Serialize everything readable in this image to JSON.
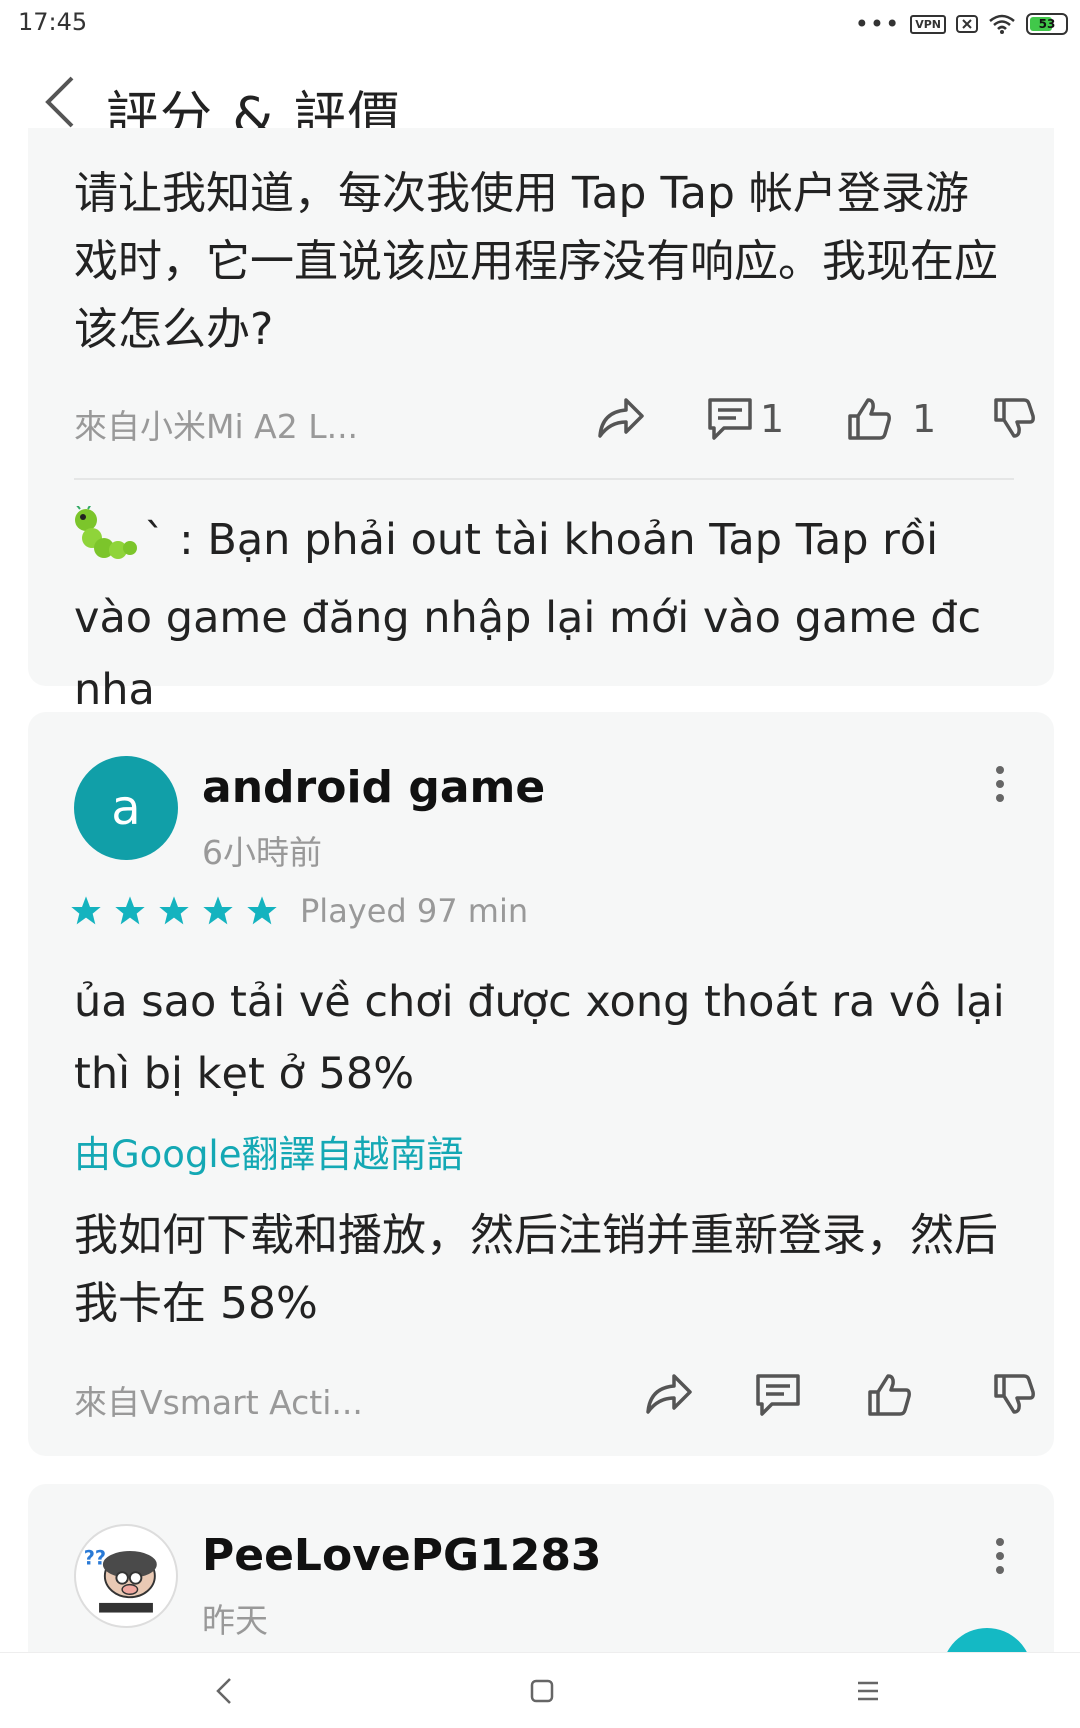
{
  "status_bar": {
    "time": "17:45",
    "vpn_label": "VPN",
    "battery_level": "53"
  },
  "header": {
    "title": "評分 & 評價"
  },
  "card1": {
    "text": "请让我知道，每次我使用 Tap Tap 帐户登录游戏时，它一直说该应用程序没有响应。我现在应该怎么办?",
    "device": "來自小米Mi A2 L...",
    "comment_count": "1",
    "like_count": "1",
    "reply_author": "`",
    "reply_text": " : Bạn phải out tài khoản Tap Tap rồi vào game đăng nhập lại mới vào game đc nha"
  },
  "card2": {
    "avatar_letter": "a",
    "username": "android game",
    "time_ago": "6小時前",
    "rating": 5,
    "played": "Played 97 min",
    "original_text": "ủa sao tải về chơi được xong thoát ra vô lại thì bị kẹt ở 58%",
    "translate_note": "由Google翻譯自越南語",
    "translated_text": "我如何下载和播放，然后注销并重新登录，然后我卡在 58%",
    "device": "來自Vsmart Acti..."
  },
  "card3": {
    "username": "PeeLovePG1283",
    "time_ago": "昨天"
  },
  "colors": {
    "accent": "#14a8b4",
    "star": "#14b3bf",
    "avatar_bg": "#119fa8",
    "card_bg": "#f6f7f7"
  },
  "icons": [
    "back-icon",
    "share-icon",
    "comment-icon",
    "thumbs-up-icon",
    "thumbs-down-icon",
    "more-vertical-icon",
    "star-icon",
    "caterpillar-emoji"
  ]
}
